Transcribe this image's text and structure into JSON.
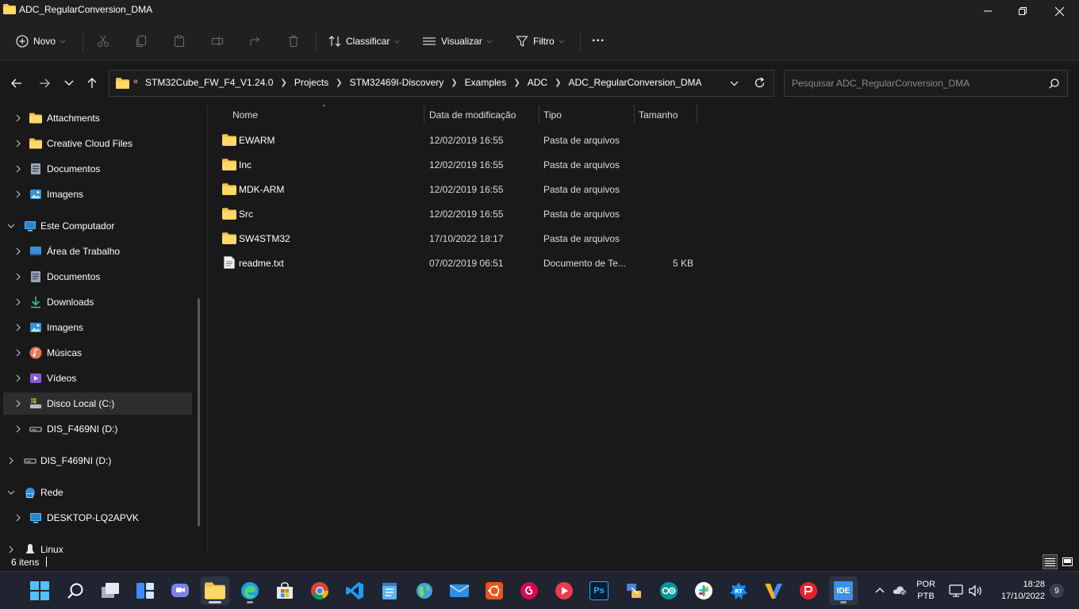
{
  "window": {
    "title": "ADC_RegularConversion_DMA"
  },
  "commandbar": {
    "new_label": "Novo",
    "sort_label": "Classificar",
    "view_label": "Visualizar",
    "filter_label": "Filtro",
    "more_label": "..."
  },
  "address": {
    "overflow": "«",
    "crumbs": [
      "STM32Cube_FW_F4_V1.24.0",
      "Projects",
      "STM32469I-Discovery",
      "Examples",
      "ADC",
      "ADC_RegularConversion_DMA"
    ],
    "search_placeholder": "Pesquisar ADC_RegularConversion_DMA"
  },
  "sidebar": {
    "items": [
      {
        "label": "Attachments",
        "icon": "folder-icon"
      },
      {
        "label": "Creative Cloud Files",
        "icon": "folder-icon"
      },
      {
        "label": "Documentos",
        "icon": "documents-icon"
      },
      {
        "label": "Imagens",
        "icon": "pictures-icon"
      },
      {
        "label": "Este Computador",
        "icon": "computer-icon"
      },
      {
        "label": "Área de Trabalho",
        "icon": "desktop-icon"
      },
      {
        "label": "Documentos",
        "icon": "documents-icon"
      },
      {
        "label": "Downloads",
        "icon": "downloads-icon"
      },
      {
        "label": "Imagens",
        "icon": "pictures-icon"
      },
      {
        "label": "Músicas",
        "icon": "music-icon"
      },
      {
        "label": "Vídeos",
        "icon": "videos-icon"
      },
      {
        "label": "Disco Local (C:)",
        "icon": "drive-icon"
      },
      {
        "label": "DIS_F469NI (D:)",
        "icon": "usb-drive-icon"
      },
      {
        "label": "DIS_F469NI (D:)",
        "icon": "usb-drive-icon"
      },
      {
        "label": "Rede",
        "icon": "network-icon"
      },
      {
        "label": "DESKTOP-LQ2APVK",
        "icon": "computer-icon"
      },
      {
        "label": "Linux",
        "icon": "linux-icon"
      }
    ]
  },
  "filelist": {
    "columns": {
      "name": "Nome",
      "date": "Data de modificação",
      "type": "Tipo",
      "size": "Tamanho"
    },
    "rows": [
      {
        "name": "EWARM",
        "date": "12/02/2019 16:55",
        "type": "Pasta de arquivos",
        "size": ""
      },
      {
        "name": "Inc",
        "date": "12/02/2019 16:55",
        "type": "Pasta de arquivos",
        "size": ""
      },
      {
        "name": "MDK-ARM",
        "date": "12/02/2019 16:55",
        "type": "Pasta de arquivos",
        "size": ""
      },
      {
        "name": "Src",
        "date": "12/02/2019 16:55",
        "type": "Pasta de arquivos",
        "size": ""
      },
      {
        "name": "SW4STM32",
        "date": "17/10/2022 18:17",
        "type": "Pasta de arquivos",
        "size": ""
      },
      {
        "name": "readme.txt",
        "date": "07/02/2019 06:51",
        "type": "Documento de Te...",
        "size": "5 KB"
      }
    ]
  },
  "status": {
    "item_count": "6 itens"
  },
  "taskbar": {
    "lang_line1": "POR",
    "lang_line2": "PTB",
    "time": "18:28",
    "date": "17/10/2022",
    "notifications": "9",
    "ps_label": "Ps",
    "ide_label": "IDE",
    "rt_label": "RT"
  },
  "colors": {
    "folder": "#f3c14d",
    "accent": "#4cc2ff",
    "background": "#191919"
  }
}
